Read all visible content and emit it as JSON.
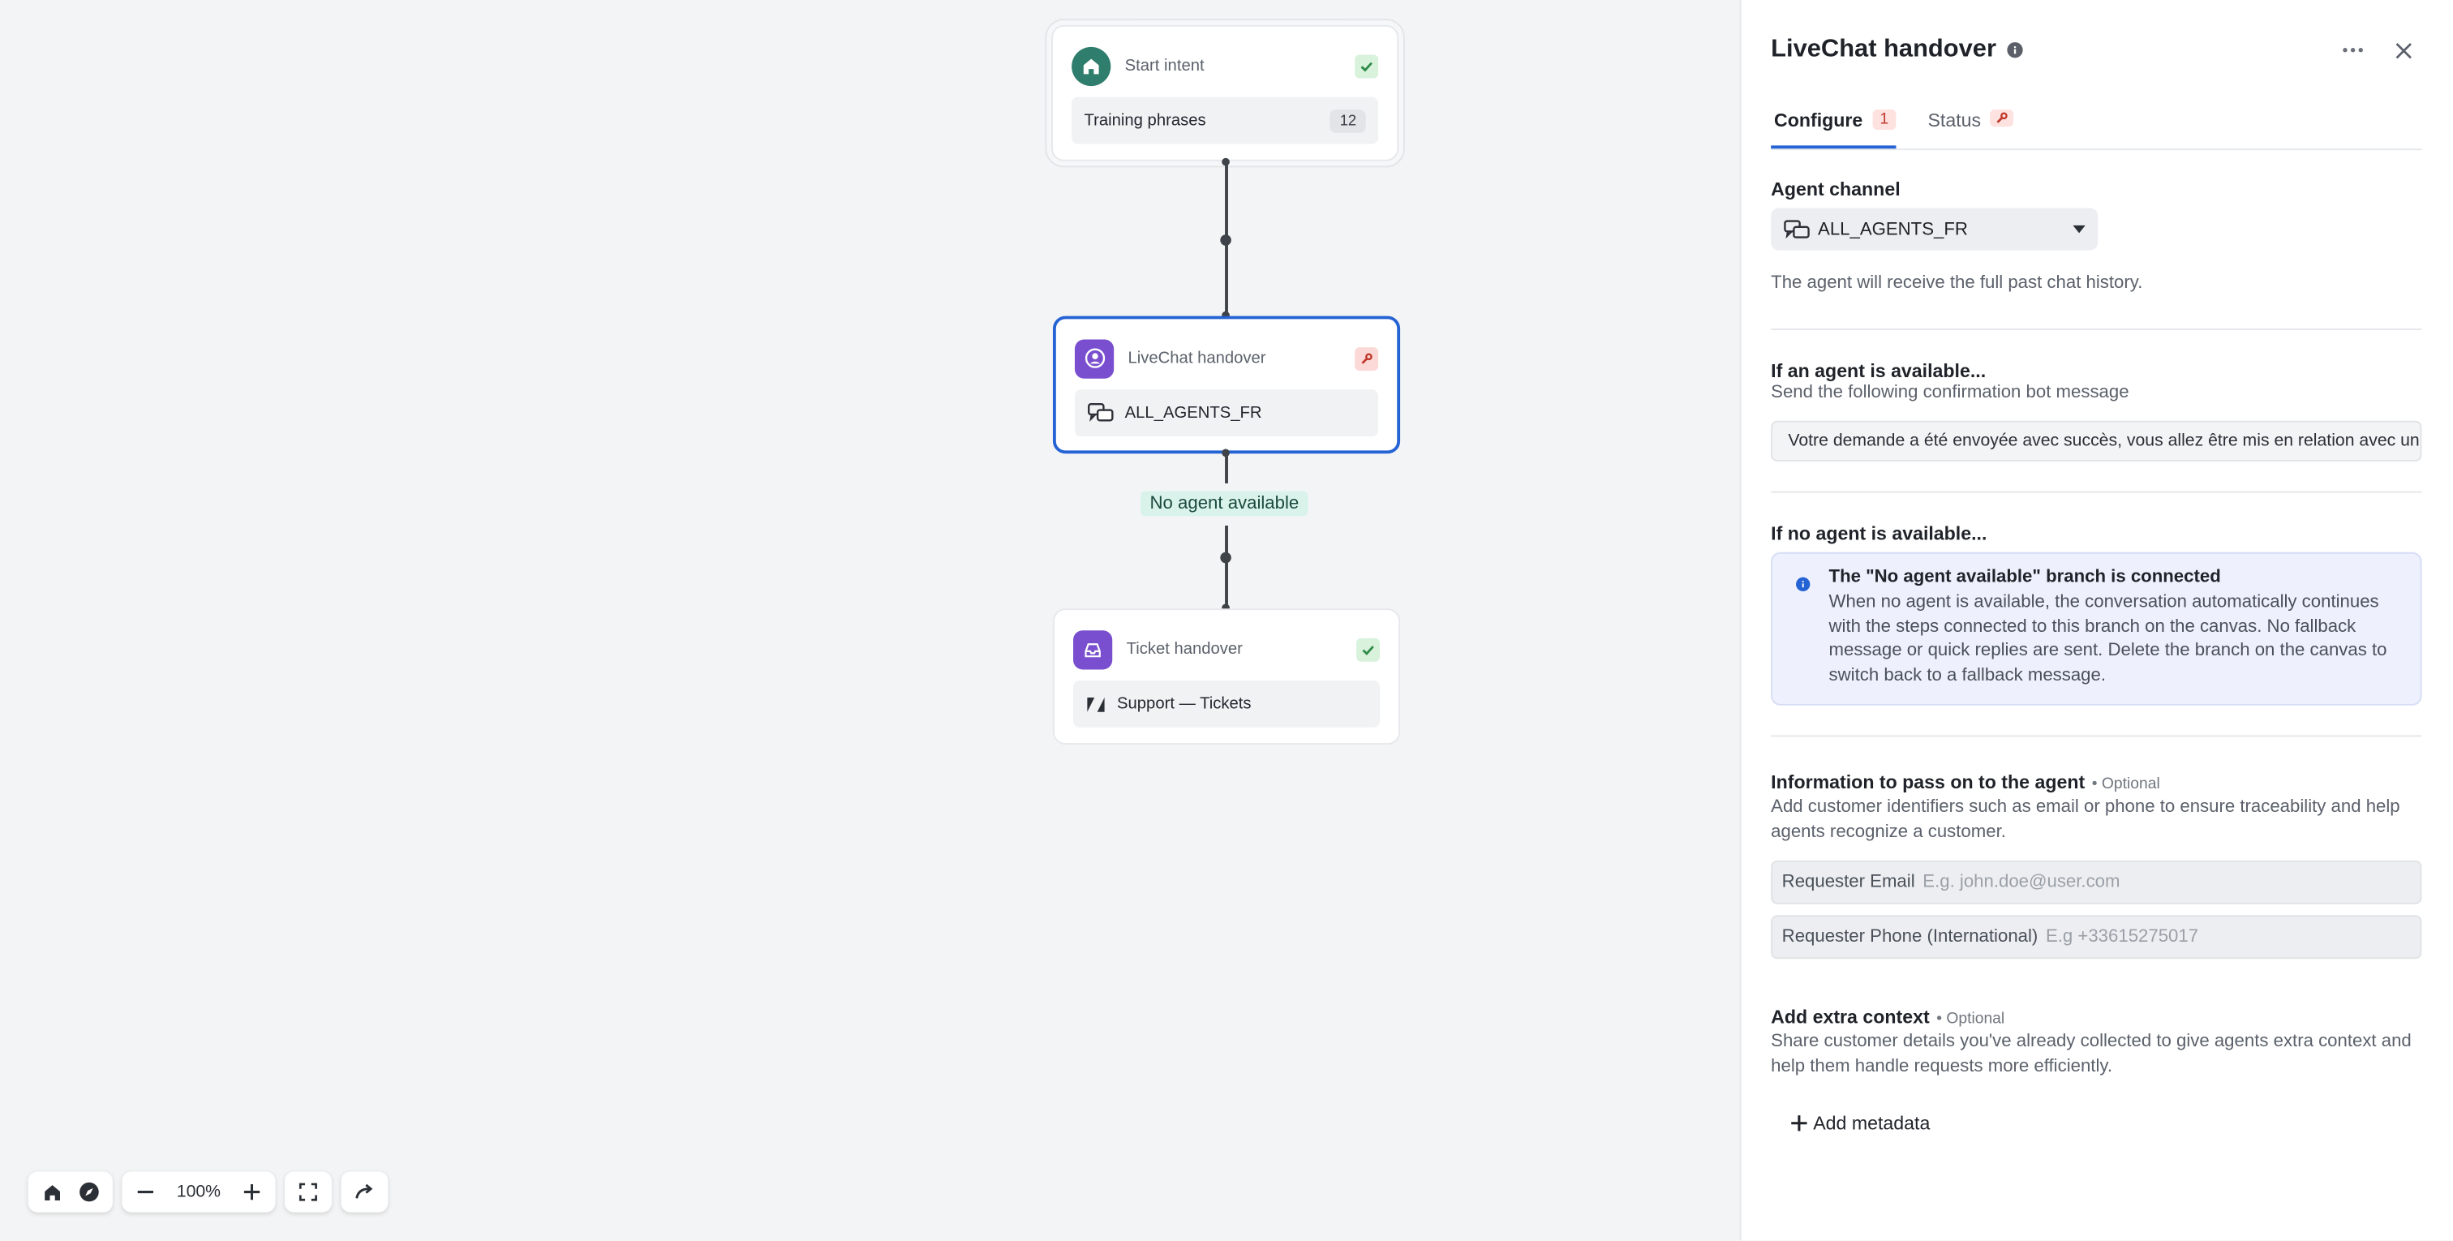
{
  "canvas": {
    "nodes": {
      "start": {
        "title": "Start intent",
        "body": "Training phrases",
        "count": "12"
      },
      "livechat": {
        "title": "LiveChat handover",
        "body": "ALL_AGENTS_FR"
      },
      "ticket": {
        "title": "Ticket handover",
        "body": "Support — Tickets"
      }
    },
    "branch_label": "No agent available",
    "toolbar": {
      "zoom": "100%"
    }
  },
  "panel": {
    "title": "LiveChat handover",
    "tabs": [
      {
        "label": "Configure",
        "badge": "1"
      },
      {
        "label": "Status"
      }
    ],
    "agent_channel": {
      "label": "Agent channel",
      "value": "ALL_AGENTS_FR",
      "help": "The agent will receive the full past chat history."
    },
    "agent_available": {
      "label": "If an agent is available...",
      "sub": "Send the following confirmation bot message",
      "message": "Votre demande a été envoyée avec succès, vous allez être mis en relation avec un agent."
    },
    "no_agent": {
      "label": "If no agent is available...",
      "callout_title": "The \"No agent available\" branch is connected",
      "callout_text": "When no agent is available, the conversation automatically continues with the steps connected to this branch on the canvas. No fallback message or quick replies are sent. Delete the branch on the canvas to switch back to a fallback message."
    },
    "info_pass": {
      "label": "Information to pass on to the agent",
      "optional": "• Optional",
      "desc": "Add customer identifiers such as email or phone to ensure traceability and help agents recognize a customer.",
      "fields": [
        {
          "label": "Requester Email",
          "placeholder": "E.g. john.doe@user.com"
        },
        {
          "label": "Requester Phone (International)",
          "placeholder": "E.g +33615275017"
        }
      ]
    },
    "extra_context": {
      "label": "Add extra context",
      "optional": "• Optional",
      "desc": "Share customer details you've already collected to give agents extra context and help them handle requests more efficiently.",
      "add_label": "Add metadata"
    }
  },
  "colors": {
    "accent": "#2563d4",
    "start_icon": "#2f7d6d",
    "handover_icon": "#7a4fcf",
    "branch_bg": "#d9f3ea",
    "warn_bg": "#fbd9d6",
    "ok_bg": "#d8f2dc"
  }
}
